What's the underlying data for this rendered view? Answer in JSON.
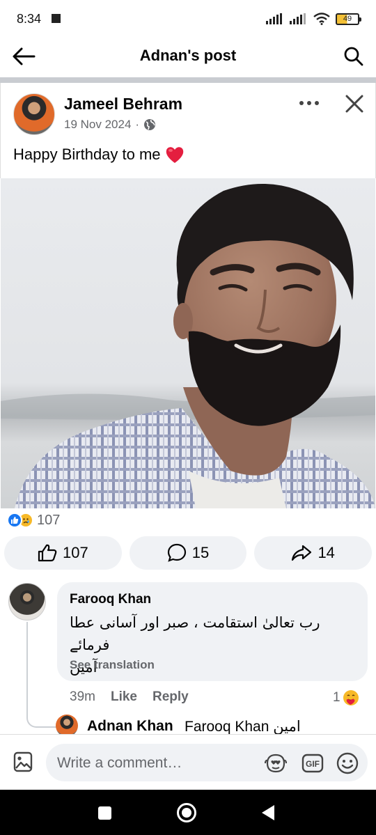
{
  "status_bar": {
    "time": "8:34",
    "battery": "49"
  },
  "header": {
    "title": "Adnan's post"
  },
  "post": {
    "author": "Jameel Behram",
    "date": "19 Nov 2024",
    "separator": "·",
    "text": "Happy Birthday to me",
    "reactions_count": "107",
    "actions": {
      "like_count": "107",
      "comment_count": "15",
      "share_count": "14"
    }
  },
  "comment": {
    "author": "Farooq Khan",
    "text_line1": "رب تعالیٰ استقامت ، صبر اور آسانی عطا فرمائے",
    "text_line2": "آمین",
    "see_translation": "See translation",
    "time": "39m",
    "like_label": "Like",
    "reply_label": "Reply",
    "reaction_count": "1"
  },
  "reply": {
    "author": "Adnan Khan",
    "tag": "Farooq Khan",
    "text": "امین"
  },
  "composer": {
    "placeholder": "Write a comment…"
  },
  "colors": {
    "brand_blue": "#1877f2",
    "secondary_text": "#65676b",
    "bubble_bg": "#f0f2f5",
    "heart_red": "#e41e3f"
  }
}
